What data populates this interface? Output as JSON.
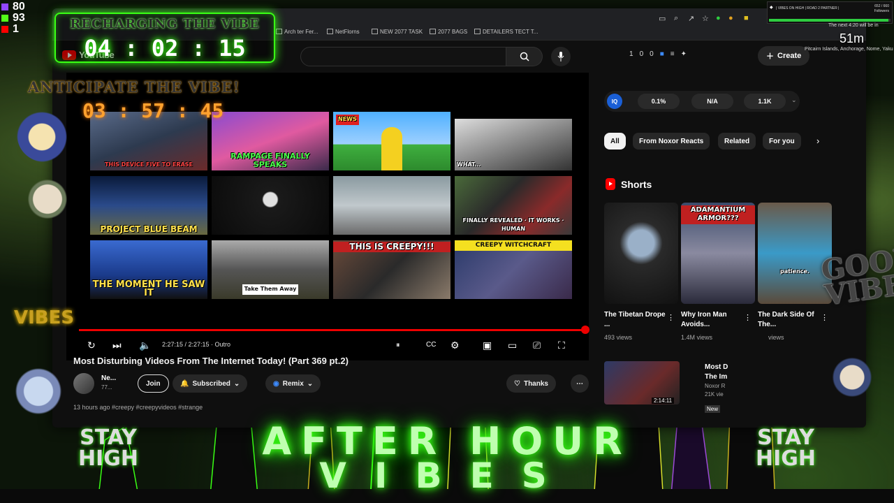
{
  "stream_counters": [
    {
      "icon": "twitch-icon",
      "value": "80",
      "color": "#9146ff"
    },
    {
      "icon": "kick-icon",
      "value": "93",
      "color": "#53fc18"
    },
    {
      "icon": "youtube-icon",
      "value": "1",
      "color": "#ff0000"
    }
  ],
  "overlay": {
    "recharge_label": "RECHARGING THE VIBE",
    "recharge_timer": "04 : 02 : 15",
    "anticipate_label": "ANTICIPATE THE VIBE!",
    "anticipate_timer": "03 : 57 : 45",
    "good_vibes": "GOOD VIBES",
    "vibes_small": "VIBES",
    "after_hour": "AFTER HOUR",
    "vibes_big": "VIBES",
    "stay_high": "STAY HIGH",
    "accent_color": "#39ff14"
  },
  "stream_info": {
    "title": "| VIBES ON HIGH | ROAD 2 PARTNER |",
    "followers_count": "652 / 660",
    "followers_label": "Followers",
    "progress": 0.98
  },
  "weather": {
    "next_line": "The next 4:20 will be in",
    "minutes": "51m",
    "locations": "Pitcairn Islands, Anchorage, Nome, Yaku"
  },
  "bookmarks": [
    "Arch ter Fer...",
    "NetFlorns",
    "NEW 2077 TASK",
    "2077 BAGS",
    "DETAILERS TECT T..."
  ],
  "youtube": {
    "logo": "YouTube",
    "header_stats": [
      "1",
      "0",
      "0"
    ],
    "create_label": "Create"
  },
  "player": {
    "time": "2:27:15 / 2:27:15 · Outro",
    "thumbnails": [
      {
        "caption": "THIS DEVICE FIVE TO ERASE"
      },
      {
        "caption": "RAMPAGE FINALLY SPEAKS"
      },
      {
        "caption": "NEWS"
      },
      {
        "caption": "WHAT..."
      },
      {
        "caption": "PROJECT BLUE BEAM"
      },
      {
        "caption": ""
      },
      {
        "caption": ""
      },
      {
        "caption": "FINALLY REVEALED · IT WORKS · HUMAN"
      },
      {
        "caption": "THE MOMENT HE SAW IT"
      },
      {
        "caption": "Take Them Away"
      },
      {
        "caption": "THIS IS CREEPY!!!"
      },
      {
        "caption": "CREEPY WITCHCRAFT"
      }
    ]
  },
  "video": {
    "title": "Most Disturbing Videos From The Internet Today! (Part 369 pt.2)",
    "channel_name": "Ne...",
    "channel_subs": "77...",
    "join_label": "Join",
    "subscribed_label": "Subscribed",
    "remix_label": "Remix",
    "thanks_label": "Thanks",
    "description": "13 hours ago  #creepy #creepyvideos #strange"
  },
  "sidebar": {
    "stats": [
      "0.1%",
      "N/A",
      "1.1K"
    ],
    "stats_icon": "IQ",
    "chips": [
      "All",
      "From Noxor Reacts",
      "Related",
      "For you"
    ],
    "shorts_label": "Shorts",
    "shorts": [
      {
        "title": "The Tibetan Drope ...",
        "views": "493 views",
        "caption": ""
      },
      {
        "title": "Why Iron Man Avoids...",
        "views": "1.4M views",
        "caption": "ADAMANTIUM ARMOR???"
      },
      {
        "title": "The Dark Side Of The...",
        "views": "views",
        "caption": "patience."
      }
    ],
    "recommended": {
      "title": "Most D The Im",
      "channel": "Noxor R",
      "views": "21K vie",
      "duration": "2:14:11",
      "badge": "New"
    }
  }
}
